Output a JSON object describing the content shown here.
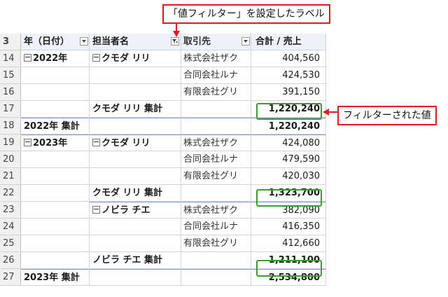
{
  "header": {
    "row_number": "3",
    "col_a": "年（日付）",
    "col_b": "担当者名",
    "col_c": "取引先",
    "col_d": "合計 / 売上"
  },
  "rows": [
    {
      "n": "14",
      "a": "2022年",
      "b": "クモダ リリ",
      "c": "株式会社ザク",
      "d": "404,560"
    },
    {
      "n": "15",
      "a": "",
      "b": "",
      "c": "合同会社ルナ",
      "d": "424,530"
    },
    {
      "n": "16",
      "a": "",
      "b": "",
      "c": "有限会社グリ",
      "d": "391,150"
    },
    {
      "n": "17",
      "a": "",
      "b": "クモダ リリ 集計",
      "c": "",
      "d": "1,220,240"
    },
    {
      "n": "18",
      "a": "2022年 集計",
      "b": "",
      "c": "",
      "d": "1,220,240"
    },
    {
      "n": "19",
      "a": "2023年",
      "b": "クモダ リリ",
      "c": "株式会社ザク",
      "d": "424,080"
    },
    {
      "n": "20",
      "a": "",
      "b": "",
      "c": "合同会社ルナ",
      "d": "479,590"
    },
    {
      "n": "21",
      "a": "",
      "b": "",
      "c": "有限会社グリ",
      "d": "420,030"
    },
    {
      "n": "22",
      "a": "",
      "b": "クモダ リリ 集計",
      "c": "",
      "d": "1,323,700"
    },
    {
      "n": "23",
      "a": "",
      "b": "ノビラ チエ",
      "c": "株式会社ザク",
      "d": "382,090"
    },
    {
      "n": "24",
      "a": "",
      "b": "",
      "c": "合同会社ルナ",
      "d": "416,350"
    },
    {
      "n": "25",
      "a": "",
      "b": "",
      "c": "有限会社グリ",
      "d": "412,660"
    },
    {
      "n": "26",
      "a": "",
      "b": "ノビラ チエ 集計",
      "c": "",
      "d": "1,211,100"
    },
    {
      "n": "27",
      "a": "2023年 集計",
      "b": "",
      "c": "",
      "d": "2,534,800"
    }
  ],
  "callouts": {
    "top": "「値フィルター」を設定したラベル",
    "right": "フィルターされた値"
  },
  "colors": {
    "callout_border": "#e01b1b",
    "highlight_border": "#3f9a32",
    "header_bg": "#eef2f8"
  }
}
